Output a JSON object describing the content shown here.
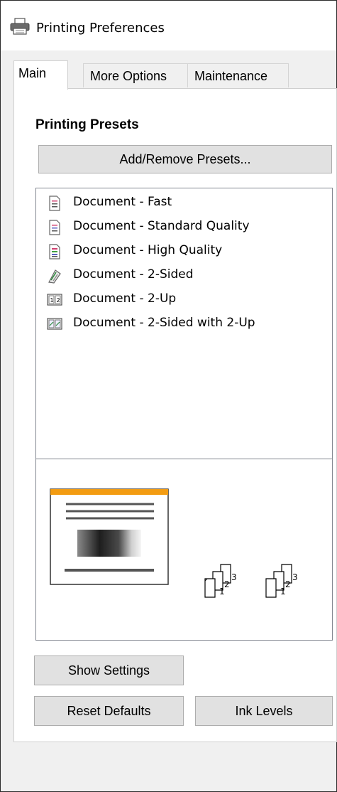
{
  "window": {
    "title": "Printing Preferences"
  },
  "tabs": [
    {
      "label": "Main",
      "active": true
    },
    {
      "label": "More Options",
      "active": false
    },
    {
      "label": "Maintenance",
      "active": false
    }
  ],
  "main": {
    "section_title": "Printing Presets",
    "add_remove_label": "Add/Remove Presets...",
    "presets": [
      {
        "label": "Document - Fast",
        "icon": "document-fast-icon"
      },
      {
        "label": "Document - Standard Quality",
        "icon": "document-standard-icon"
      },
      {
        "label": "Document - High Quality",
        "icon": "document-high-quality-icon"
      },
      {
        "label": "Document - 2-Sided",
        "icon": "document-2-sided-icon"
      },
      {
        "label": "Document - 2-Up",
        "icon": "document-2-up-icon"
      },
      {
        "label": "Document - 2-Sided with 2-Up",
        "icon": "document-2-sided-2-up-icon"
      }
    ],
    "preview": {
      "collate_1": [
        "1",
        "2",
        "3"
      ],
      "collate_2": [
        "1",
        "2",
        "3"
      ]
    },
    "show_settings_label": "Show Settings",
    "reset_defaults_label": "Reset Defaults",
    "ink_levels_label": "Ink Levels"
  },
  "colors": {
    "preview_accent": "#f39c12"
  }
}
